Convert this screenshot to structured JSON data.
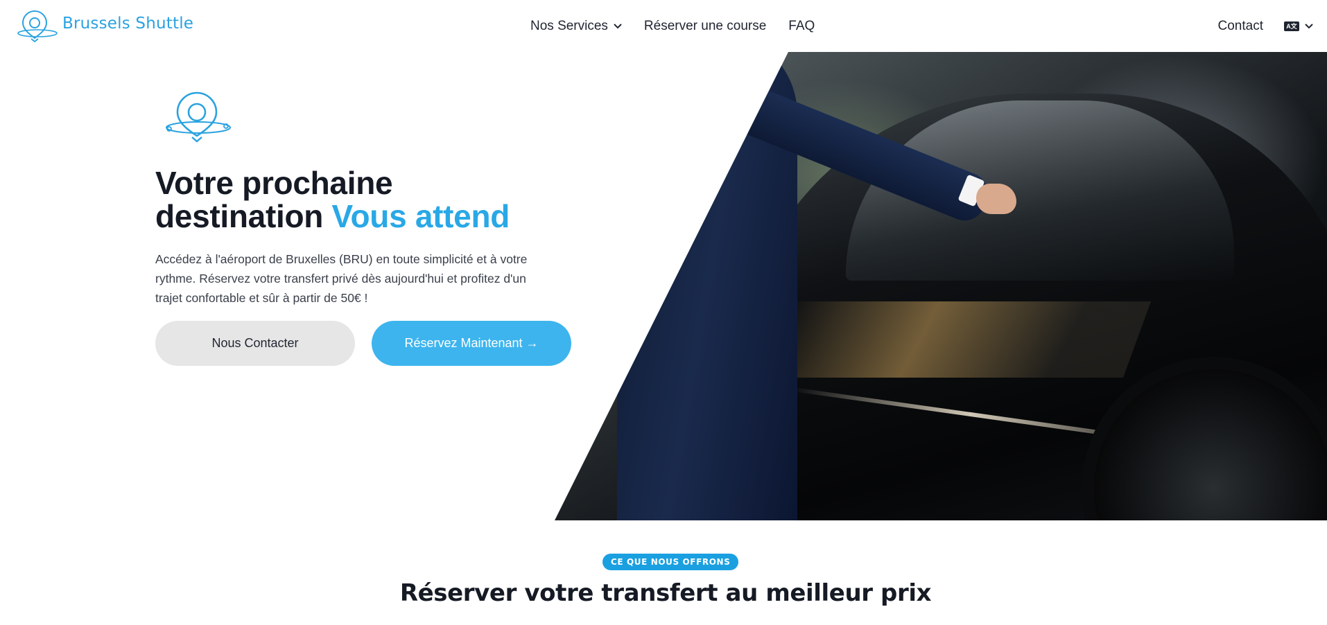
{
  "brand": {
    "name": "Brussels Shuttle",
    "logo_icon": "map-pin-orbit-icon",
    "accent_color": "#2aa2e0"
  },
  "nav": {
    "items": [
      {
        "label": "Nos Services",
        "has_dropdown": true
      },
      {
        "label": "Réserver une course"
      },
      {
        "label": "FAQ"
      }
    ],
    "contact_label": "Contact",
    "language_icon": "language-icon"
  },
  "hero": {
    "title_line1": "Votre prochaine",
    "title_line2": "destination ",
    "title_accent": "Vous attend",
    "description": "Accédez à l'aéroport de Bruxelles (BRU) en toute simplicité et à votre rythme. Réservez votre transfert privé dès aujourd'hui et profitez d'un trajet confortable et sûr à partir de 50€ !",
    "buttons": {
      "contact": "Nous Contacter",
      "book": "Réservez Maintenant →"
    },
    "image_alt": "chauffeur-opening-car-door"
  },
  "section": {
    "badge": "CE QUE NOUS OFFRONS",
    "title": "Réserver votre transfert au meilleur prix"
  },
  "colors": {
    "primary": "#3db4ee",
    "badge": "#1aa0e0",
    "text_dark": "#151a24"
  }
}
